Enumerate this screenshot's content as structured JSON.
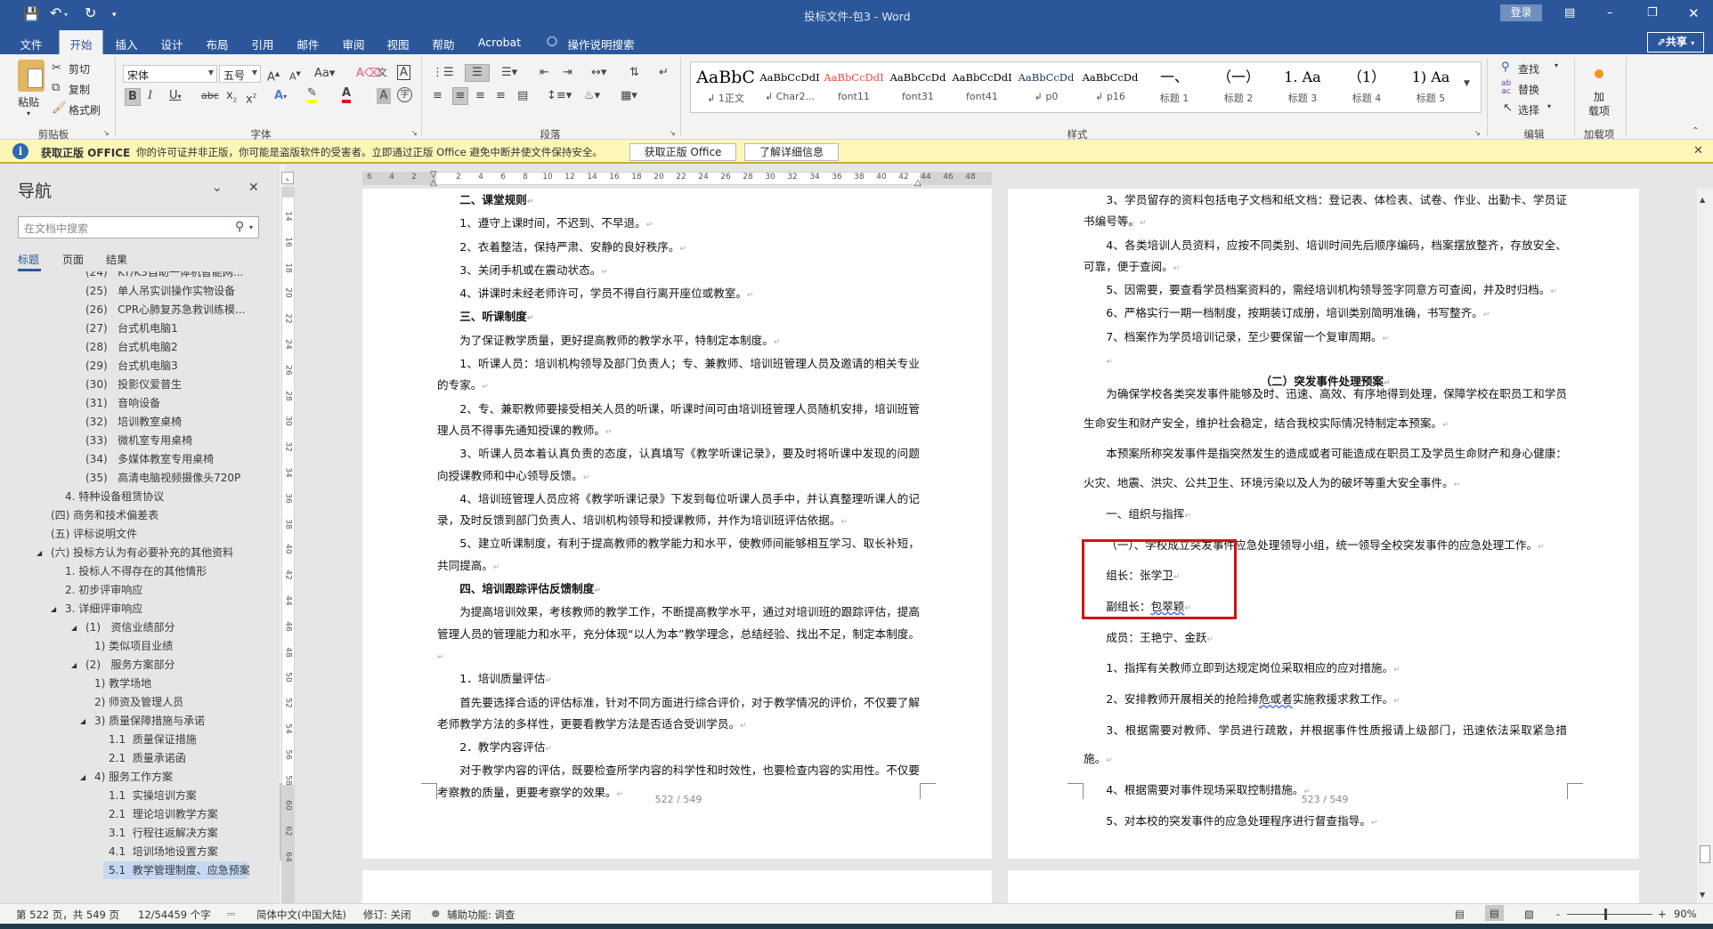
{
  "titlebar": {
    "title": "投标文件-包3  -  Word",
    "login": "登录",
    "share": "共享"
  },
  "tabs": [
    {
      "label": "文件"
    },
    {
      "label": "开始",
      "active": true
    },
    {
      "label": "插入"
    },
    {
      "label": "设计"
    },
    {
      "label": "布局"
    },
    {
      "label": "引用"
    },
    {
      "label": "邮件"
    },
    {
      "label": "审阅"
    },
    {
      "label": "视图"
    },
    {
      "label": "帮助"
    },
    {
      "label": "Acrobat"
    }
  ],
  "tell_me": "操作说明搜索",
  "ribbon": {
    "clipboard": {
      "paste": "粘贴",
      "cut": "剪切",
      "copy": "复制",
      "format_painter": "格式刷",
      "label": "剪贴板"
    },
    "font": {
      "name": "宋体",
      "size": "五号",
      "label": "字体",
      "font_color": "#e81123",
      "highlight_color": "#ffff00"
    },
    "paragraph": {
      "label": "段落"
    },
    "styles": {
      "label": "样式",
      "items": [
        {
          "preview": "AaBbC",
          "name": "↲ 1正文",
          "color": "#000000"
        },
        {
          "preview": "AaBbCcDdI",
          "name": "↲ Char2...",
          "color": "#000000"
        },
        {
          "preview": "AaBbCcDdI",
          "name": "font11",
          "color": "#e8473a"
        },
        {
          "preview": "AaBbCcDd",
          "name": "font31",
          "color": "#000000"
        },
        {
          "preview": "AaBbCcDdI",
          "name": "font41",
          "color": "#000000"
        },
        {
          "preview": "AaBbCcDd",
          "name": "↲ p0",
          "color": "#1f2f5a"
        },
        {
          "preview": "AaBbCcDd",
          "name": "↲ p16",
          "color": "#000000"
        },
        {
          "preview": "一、",
          "name": "标题 1",
          "color": "#000000"
        },
        {
          "preview": "（一）",
          "name": "标题 2",
          "color": "#000000"
        },
        {
          "preview": "1.  Aa",
          "name": "标题 3",
          "color": "#000000"
        },
        {
          "preview": "（1）",
          "name": "标题 4",
          "color": "#000000"
        },
        {
          "preview": "1)  Aa",
          "name": "标题 5",
          "color": "#000000"
        }
      ]
    },
    "editing": {
      "find": "查找",
      "replace": "替换",
      "select": "选择",
      "label": "编辑"
    },
    "addins": {
      "button": "加\n载项",
      "label": "加载项"
    }
  },
  "infobar": {
    "title": "获取正版 OFFICE",
    "message": "你的许可证并非正版，你可能是盗版软件的受害者。立即通过正版 Office 避免中断并使文件保持安全。",
    "get_button": "获取正版 Office",
    "learn_button": "了解详细信息"
  },
  "nav": {
    "title": "导航",
    "search_placeholder": "在文档中搜索",
    "tabs": [
      "标题",
      "页面",
      "结果"
    ],
    "active_tab": 0,
    "items": [
      {
        "text": "(24)   KT/K3自助一体机智能网...",
        "level": 5
      },
      {
        "text": "(25)   单人吊实训操作实物设备",
        "level": 5
      },
      {
        "text": "(26)   CPR心肺复苏急救训练模...",
        "level": 5
      },
      {
        "text": "(27)   台式机电脑1",
        "level": 5
      },
      {
        "text": "(28)   台式机电脑2",
        "level": 5
      },
      {
        "text": "(29)   台式机电脑3",
        "level": 5
      },
      {
        "text": "(30)   投影仪爱普生",
        "level": 5
      },
      {
        "text": "(31)   音响设备",
        "level": 5
      },
      {
        "text": "(32)   培训教室桌椅",
        "level": 5
      },
      {
        "text": "(33)   微机室专用桌椅",
        "level": 5
      },
      {
        "text": "(34)   多媒体教室专用桌椅",
        "level": 5
      },
      {
        "text": "(35)   高清电脑视频摄像头720P",
        "level": 5
      },
      {
        "text": "4. 特种设备租赁协议",
        "level": 4
      },
      {
        "text": "(四) 商务和技术偏差表",
        "level": 3
      },
      {
        "text": "(五) 评标说明文件",
        "level": 3
      },
      {
        "text": "(六) 投标方认为有必要补充的其他资料",
        "level": 3,
        "expanded": true
      },
      {
        "text": "1. 投标人不得存在的其他情形",
        "level": 4
      },
      {
        "text": "2. 初步评审响应",
        "level": 4
      },
      {
        "text": "3. 详细评审响应",
        "level": 4,
        "expanded": true
      },
      {
        "text": "(1)   资信业绩部分",
        "level": 5,
        "expanded": true
      },
      {
        "text": "1) 类似项目业绩",
        "level": 6
      },
      {
        "text": "(2)   服务方案部分",
        "level": 5,
        "expanded": true
      },
      {
        "text": "1) 教学场地",
        "level": 6
      },
      {
        "text": "2) 师资及管理人员",
        "level": 6
      },
      {
        "text": "3) 质量保障措施与承诺",
        "level": 6,
        "expanded": true
      },
      {
        "text": "1.1  质量保证措施",
        "level": 7
      },
      {
        "text": "2.1  质量承诺函",
        "level": 7
      },
      {
        "text": "4) 服务工作方案",
        "level": 6,
        "expanded": true
      },
      {
        "text": "1.1  实操培训方案",
        "level": 7
      },
      {
        "text": "2.1  理论培训教学方案",
        "level": 7
      },
      {
        "text": "3.1  行程往返解决方案",
        "level": 7
      },
      {
        "text": "4.1  培训场地设置方案",
        "level": 7
      },
      {
        "text": "5.1  教学管理制度、应急预案",
        "level": 7,
        "selected": true
      }
    ]
  },
  "ruler": {
    "horizontal": [
      -6,
      -4,
      -2,
      2,
      4,
      6,
      8,
      10,
      12,
      14,
      16,
      18,
      20,
      22,
      24,
      26,
      28,
      30,
      32,
      34,
      36,
      38,
      40,
      42,
      44,
      46,
      48
    ],
    "vertical": [
      14,
      16,
      18,
      20,
      22,
      24,
      26,
      28,
      30,
      32,
      34,
      36,
      38,
      40,
      42,
      44,
      46,
      48,
      50,
      52,
      54,
      56,
      58,
      60,
      62,
      64
    ]
  },
  "pages": {
    "left": {
      "page_number": "522  /  549",
      "paragraphs": [
        {
          "text": "二、课堂规则",
          "type": "h"
        },
        {
          "text": "1、遵守上课时间，不迟到、不早退。"
        },
        {
          "text": "2、衣着整洁，保持严肃、安静的良好秩序。"
        },
        {
          "text": "3、关闭手机或在震动状态。"
        },
        {
          "text": "4、讲课时未经老师许可，学员不得自行离开座位或教室。"
        },
        {
          "text": "三、听课制度",
          "type": "h"
        },
        {
          "text": "为了保证教学质量，更好提高教师的教学水平，特制定本制度。"
        },
        {
          "text": "1、听课人员：培训机构领导及部门负责人；专、兼教师、培训班管理人员及邀请的相关专业的专家。"
        },
        {
          "text": "2、专、兼职教师要接受相关人员的听课，听课时间可由培训班管理人员随机安排，培训班管理人员不得事先通知授课的教师。"
        },
        {
          "text": "3、听课人员本着认真负责的态度，认真填写《教学听课记录》，要及时将听课中发现的问题向授课教师和中心领导反馈。"
        },
        {
          "text": "4、培训班管理人员应将《教学听课记录》下发到每位听课人员手中，并认真整理听课人的记录，及时反馈到部门负责人、培训机构领导和授课教师，并作为培训班评估依据。"
        },
        {
          "text": "5、建立听课制度，有利于提高教师的教学能力和水平，使教师间能够相互学习、取长补短，共同提高。"
        },
        {
          "text": "四、培训跟踪评估反馈制度",
          "type": "h"
        },
        {
          "text": "为提高培训效果，考核教师的教学工作，不断提高教学水平，通过对培训班的跟踪评估，提高管理人员的管理能力和水平，充分体现“以人为本”教学理念，总结经验、找出不足，制定本制度。"
        },
        {
          "text": "1．培训质量评估"
        },
        {
          "text": "首先要选择合适的评估标准，针对不同方面进行综合评价，对于教学情况的评价，不仅要了解老师教学方法的多样性，更要看教学方法是否适合受训学员。"
        },
        {
          "text": "2．教学内容评估"
        },
        {
          "text": "对于教学内容的评估，既要检查所学内容的科学性和时效性，也要检查内容的实用性。不仅要考察教的质量，更要考察学的效果。"
        }
      ]
    },
    "right": {
      "page_number": "523  /  549",
      "upper": [
        {
          "text": "3、学员留存的资料包括电子文档和纸文档：登记表、体检表、试卷、作业、出勤卡、学员证书编号等。"
        },
        {
          "text": "4、各类培训人员资料，应按不同类别、培训时间先后顺序编码，档案摆放整齐，存放安全、可靠，便于查阅。"
        },
        {
          "text": "5、因需要，要查看学员档案资料的，需经培训机构领导签字同意方可查阅，并及时归档。"
        },
        {
          "text": "6、严格实行一期一档制度，按期装订成册，培训类别简明准确，书写整齐。"
        },
        {
          "text": "7、档案作为学员培训记录，至少要保留一个复审周期。"
        },
        {
          "text": "",
          "type": "empty"
        },
        {
          "text": "（二）突发事件处理预案",
          "type": "c"
        }
      ],
      "lower": [
        {
          "text": "为确保学校各类突发事件能够及时、迅速、高效、有序地得到处理，保障学校在职员工和学员生命安生和财产安全，维护社会稳定，结合我校实际情况特制定本预案。"
        },
        {
          "text": "本预案所称突发事件是指突然发生的造成或者可能造成在职员工及学员生命财产和身心健康：火灾、地震、洪灾、公共卫生、环境污染以及人为的破坏等重大安全事件。"
        },
        {
          "text": "一、组织与指挥"
        },
        {
          "text": "（一）、学校成立突发事件应急处理领导小组，统一领导全校突发事件的应急处理工作。"
        },
        {
          "text": "组长：张学卫"
        },
        {
          "text": "副组长：包翠颖",
          "squiggle": "包翠颖"
        },
        {
          "text": "成员：王艳宁、金跃"
        },
        {
          "text": "1、指挥有关教师立即到达规定岗位采取相应的应对措施。"
        },
        {
          "text": "2、安排教师开展相关的抢险排危或者实施救援求救工作。",
          "squiggle": "危或者"
        },
        {
          "text": "3、根据需要对教师、学员进行疏散，并根据事件性质报请上级部门，迅速依法采取紧急措施。"
        },
        {
          "text": "4、根据需要对事件现场采取控制措施。"
        },
        {
          "text": "5、对本校的突发事件的应急处理程序进行督查指导。"
        }
      ],
      "highlight_box_color": "#d0121b"
    }
  },
  "status": {
    "page": "第 522 页，共 549 页",
    "words": "12/54459 个字",
    "language": "简体中文(中国大陆)",
    "track_changes": "修订: 关闭",
    "accessibility": "辅助功能: 调查",
    "zoom": "90%",
    "zoom_level": 90
  },
  "colors": {
    "accent": "#2b579a",
    "infobar": "#fcf7b6",
    "selection": "#c5d8f2"
  }
}
